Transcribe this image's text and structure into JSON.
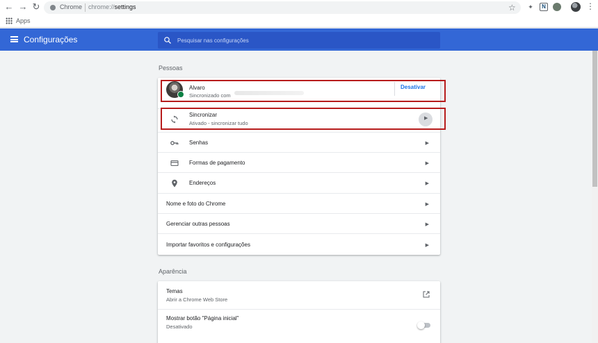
{
  "browser": {
    "omnibox_chrome_label": "Chrome",
    "omnibox_url_scheme": "chrome://",
    "omnibox_url_path": "settings",
    "extension_n_label": "N"
  },
  "bookmarks": {
    "apps_label": "Apps"
  },
  "header": {
    "title": "Configurações",
    "search_placeholder": "Pesquisar nas configurações"
  },
  "people": {
    "section_title": "Pessoas",
    "profile": {
      "name": "Alvaro",
      "status": "Sincronizado com",
      "turn_off_label": "Desativar"
    },
    "sync": {
      "label": "Sincronizar",
      "status": "Ativado - sincronizar tudo"
    },
    "items": [
      {
        "label": "Senhas",
        "icon": "key-icon"
      },
      {
        "label": "Formas de pagamento",
        "icon": "credit-card-icon"
      },
      {
        "label": "Endereços",
        "icon": "location-pin-icon"
      }
    ],
    "plain_items": [
      {
        "label": "Nome e foto do Chrome"
      },
      {
        "label": "Gerenciar outras pessoas"
      },
      {
        "label": "Importar favoritos e configurações"
      }
    ]
  },
  "appearance": {
    "section_title": "Aparência",
    "themes": {
      "label": "Temas",
      "sub": "Abrir a Chrome Web Store"
    },
    "home_button": {
      "label": "Mostrar botão \"Página inicial\"",
      "sub": "Desativado",
      "enabled": false
    }
  },
  "colors": {
    "header_blue": "#3367d6",
    "highlight_red": "#b71c1c",
    "link_blue": "#1a73e8"
  }
}
